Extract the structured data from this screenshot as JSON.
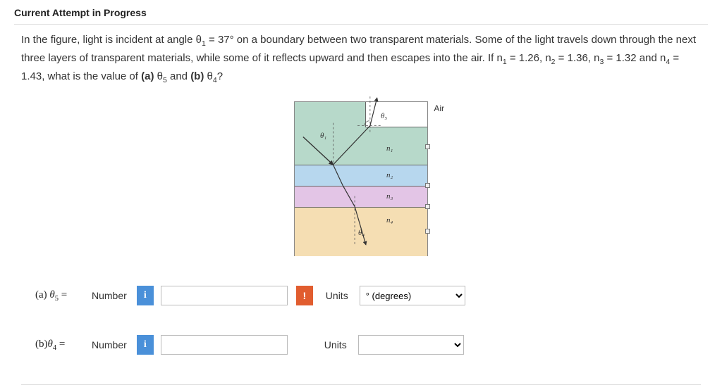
{
  "header": {
    "title": "Current Attempt in Progress"
  },
  "problem": {
    "text_html": "In the figure, light is incident at angle θ<sub>1</sub> = 37° on a boundary between two transparent materials. Some of the light travels down through the next three layers of transparent materials, while some of it reflects upward and then escapes into the air. If n<sub>1</sub> = 1.26, n<sub>2</sub> = 1.36, n<sub>3</sub> = 1.32 and n<sub>4</sub> = 1.43, what is the value of <b>(a)</b> θ<sub>5</sub> and <b>(b)</b> θ<sub>4</sub>?"
  },
  "figure": {
    "air_label": "Air",
    "theta1": "θ₁",
    "theta4": "θ₄",
    "theta5": "θ₅",
    "n1": "n₁",
    "n2": "n₂",
    "n3": "n₃",
    "n4": "n₄"
  },
  "answers": {
    "a": {
      "label_html": "(a) <i>θ</i><sub>5</sub>  =",
      "number_word": "Number",
      "info_icon": "i",
      "value": "",
      "error_icon": "!",
      "units_word": "Units",
      "units_selected": "° (degrees)"
    },
    "b": {
      "label_html": "(b)<i>θ</i><sub>4</sub>  =",
      "number_word": "Number",
      "info_icon": "i",
      "value": "",
      "units_word": "Units",
      "units_selected": ""
    }
  }
}
